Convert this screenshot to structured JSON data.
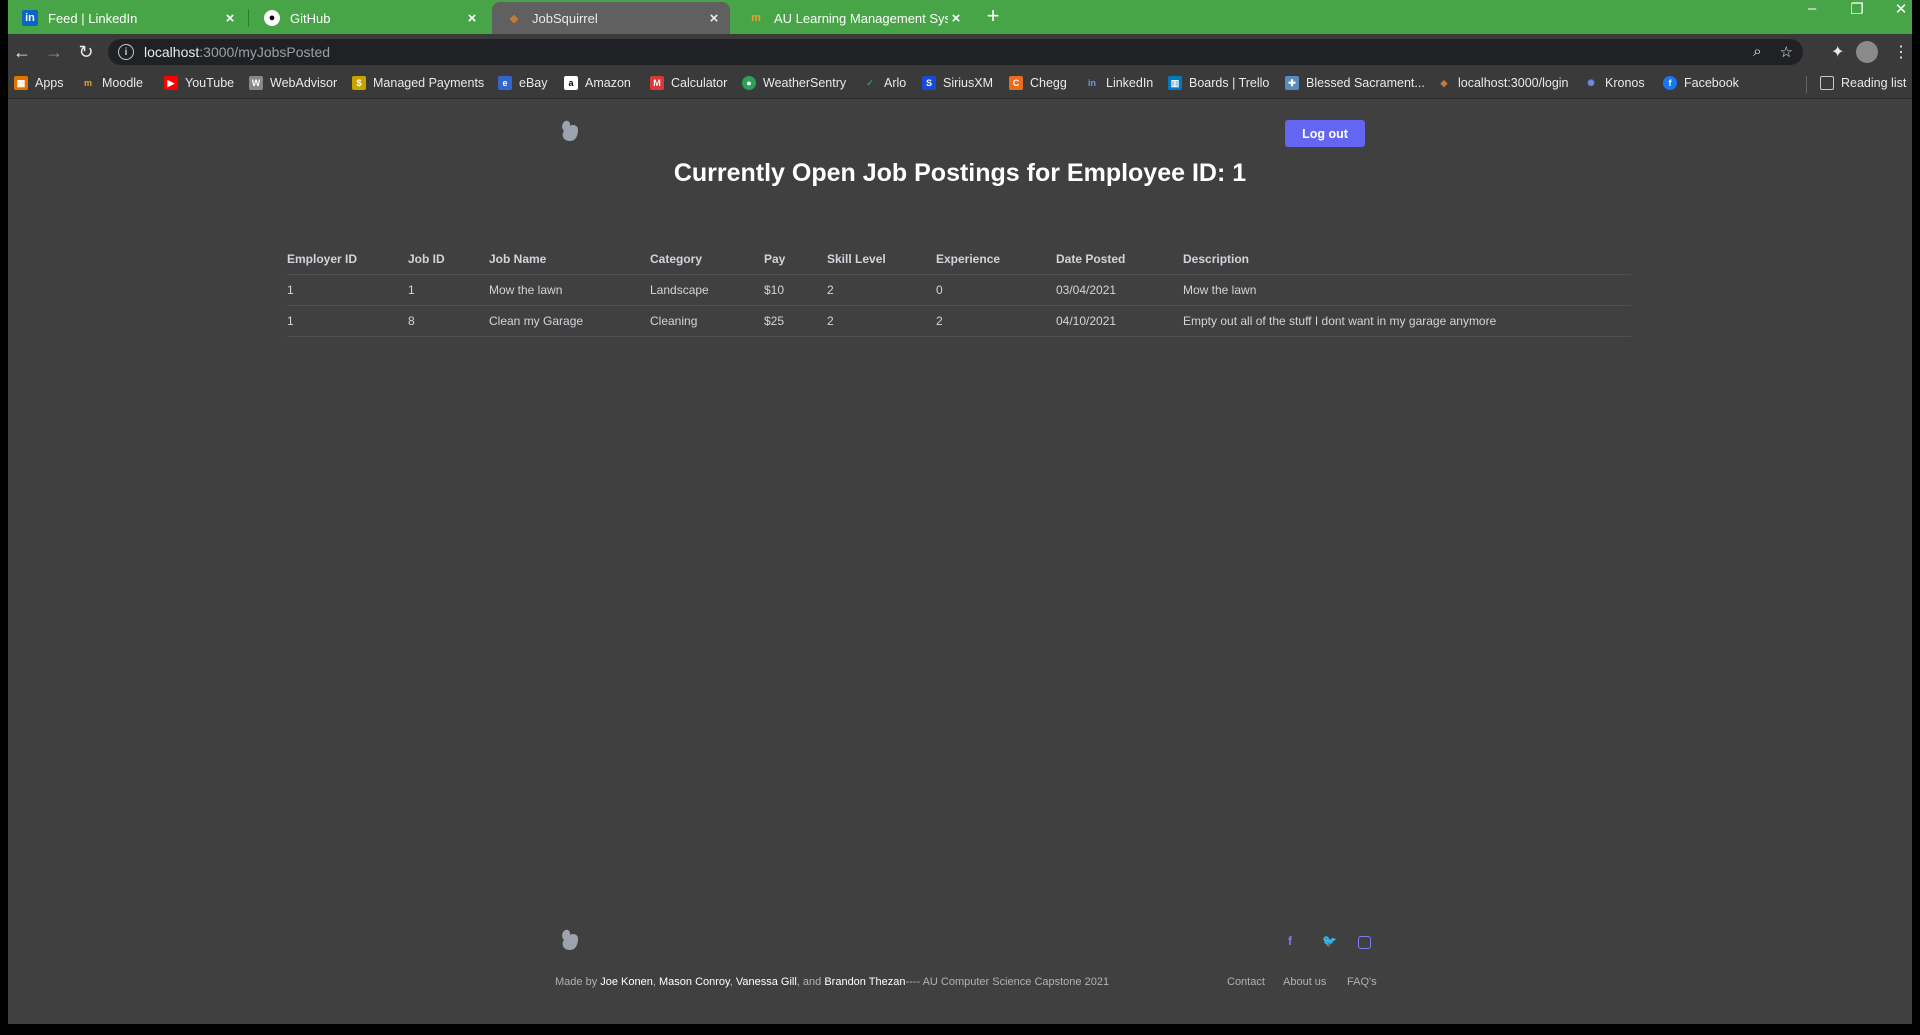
{
  "browser": {
    "tabs": [
      {
        "title": "Feed | LinkedIn",
        "icon": "linkedin-icon",
        "active": false
      },
      {
        "title": "GitHub",
        "icon": "github-icon",
        "active": false
      },
      {
        "title": "JobSquirrel",
        "icon": "squirrel-icon",
        "active": true
      },
      {
        "title": "AU Learning Management System",
        "icon": "moodle-icon",
        "active": false
      }
    ],
    "url_host": "localhost",
    "url_path": ":3000/myJobsPosted",
    "bookmarks": [
      {
        "label": "Apps",
        "icon": "apps-grid-icon"
      },
      {
        "label": "Moodle",
        "icon": "moodle-icon"
      },
      {
        "label": "YouTube",
        "icon": "youtube-icon"
      },
      {
        "label": "WebAdvisor",
        "icon": "webadvisor-icon"
      },
      {
        "label": "Managed Payments",
        "icon": "payments-icon"
      },
      {
        "label": "eBay",
        "icon": "ebay-icon"
      },
      {
        "label": "Amazon",
        "icon": "amazon-icon"
      },
      {
        "label": "Calculator",
        "icon": "calculator-icon"
      },
      {
        "label": "WeatherSentry",
        "icon": "weather-icon"
      },
      {
        "label": "Arlo",
        "icon": "arlo-icon"
      },
      {
        "label": "SiriusXM",
        "icon": "siriusxm-icon"
      },
      {
        "label": "Chegg",
        "icon": "chegg-icon"
      },
      {
        "label": "LinkedIn",
        "icon": "linkedin-icon"
      },
      {
        "label": "Boards | Trello",
        "icon": "trello-icon"
      },
      {
        "label": "Blessed Sacrament...",
        "icon": "church-icon"
      },
      {
        "label": "localhost:3000/login",
        "icon": "squirrel-icon"
      },
      {
        "label": "Kronos",
        "icon": "kronos-icon"
      },
      {
        "label": "Facebook",
        "icon": "facebook-icon"
      }
    ],
    "reading_list": "Reading list"
  },
  "header": {
    "logout_label": "Log out",
    "title": "Currently Open Job Postings for Employee ID: 1"
  },
  "table": {
    "columns": [
      "Employer ID",
      "Job ID",
      "Job Name",
      "Category",
      "Pay",
      "Skill Level",
      "Experience",
      "Date Posted",
      "Description"
    ],
    "rows": [
      [
        "1",
        "1",
        "Mow the lawn",
        "Landscape",
        "$10",
        "2",
        "0",
        "03/04/2021",
        "Mow the lawn"
      ],
      [
        "1",
        "8",
        "Clean my Garage",
        "Cleaning",
        "$25",
        "2",
        "2",
        "04/10/2021",
        "Empty out all of the stuff I dont want in my garage anymore"
      ]
    ]
  },
  "footer": {
    "made_by": "Made by",
    "authors": [
      "Joe Konen",
      "Mason Conroy",
      "Vanessa Gill",
      "Brandon Thezan"
    ],
    "and": "and",
    "suffix": "---- AU Computer Science Capstone 2021",
    "links": [
      "Contact",
      "About us",
      "FAQ's"
    ],
    "social": [
      "facebook-icon",
      "twitter-icon",
      "instagram-icon"
    ]
  },
  "colors": {
    "tab_strip": "#47a447",
    "page_bg": "#404040",
    "accent": "#6366f1"
  }
}
